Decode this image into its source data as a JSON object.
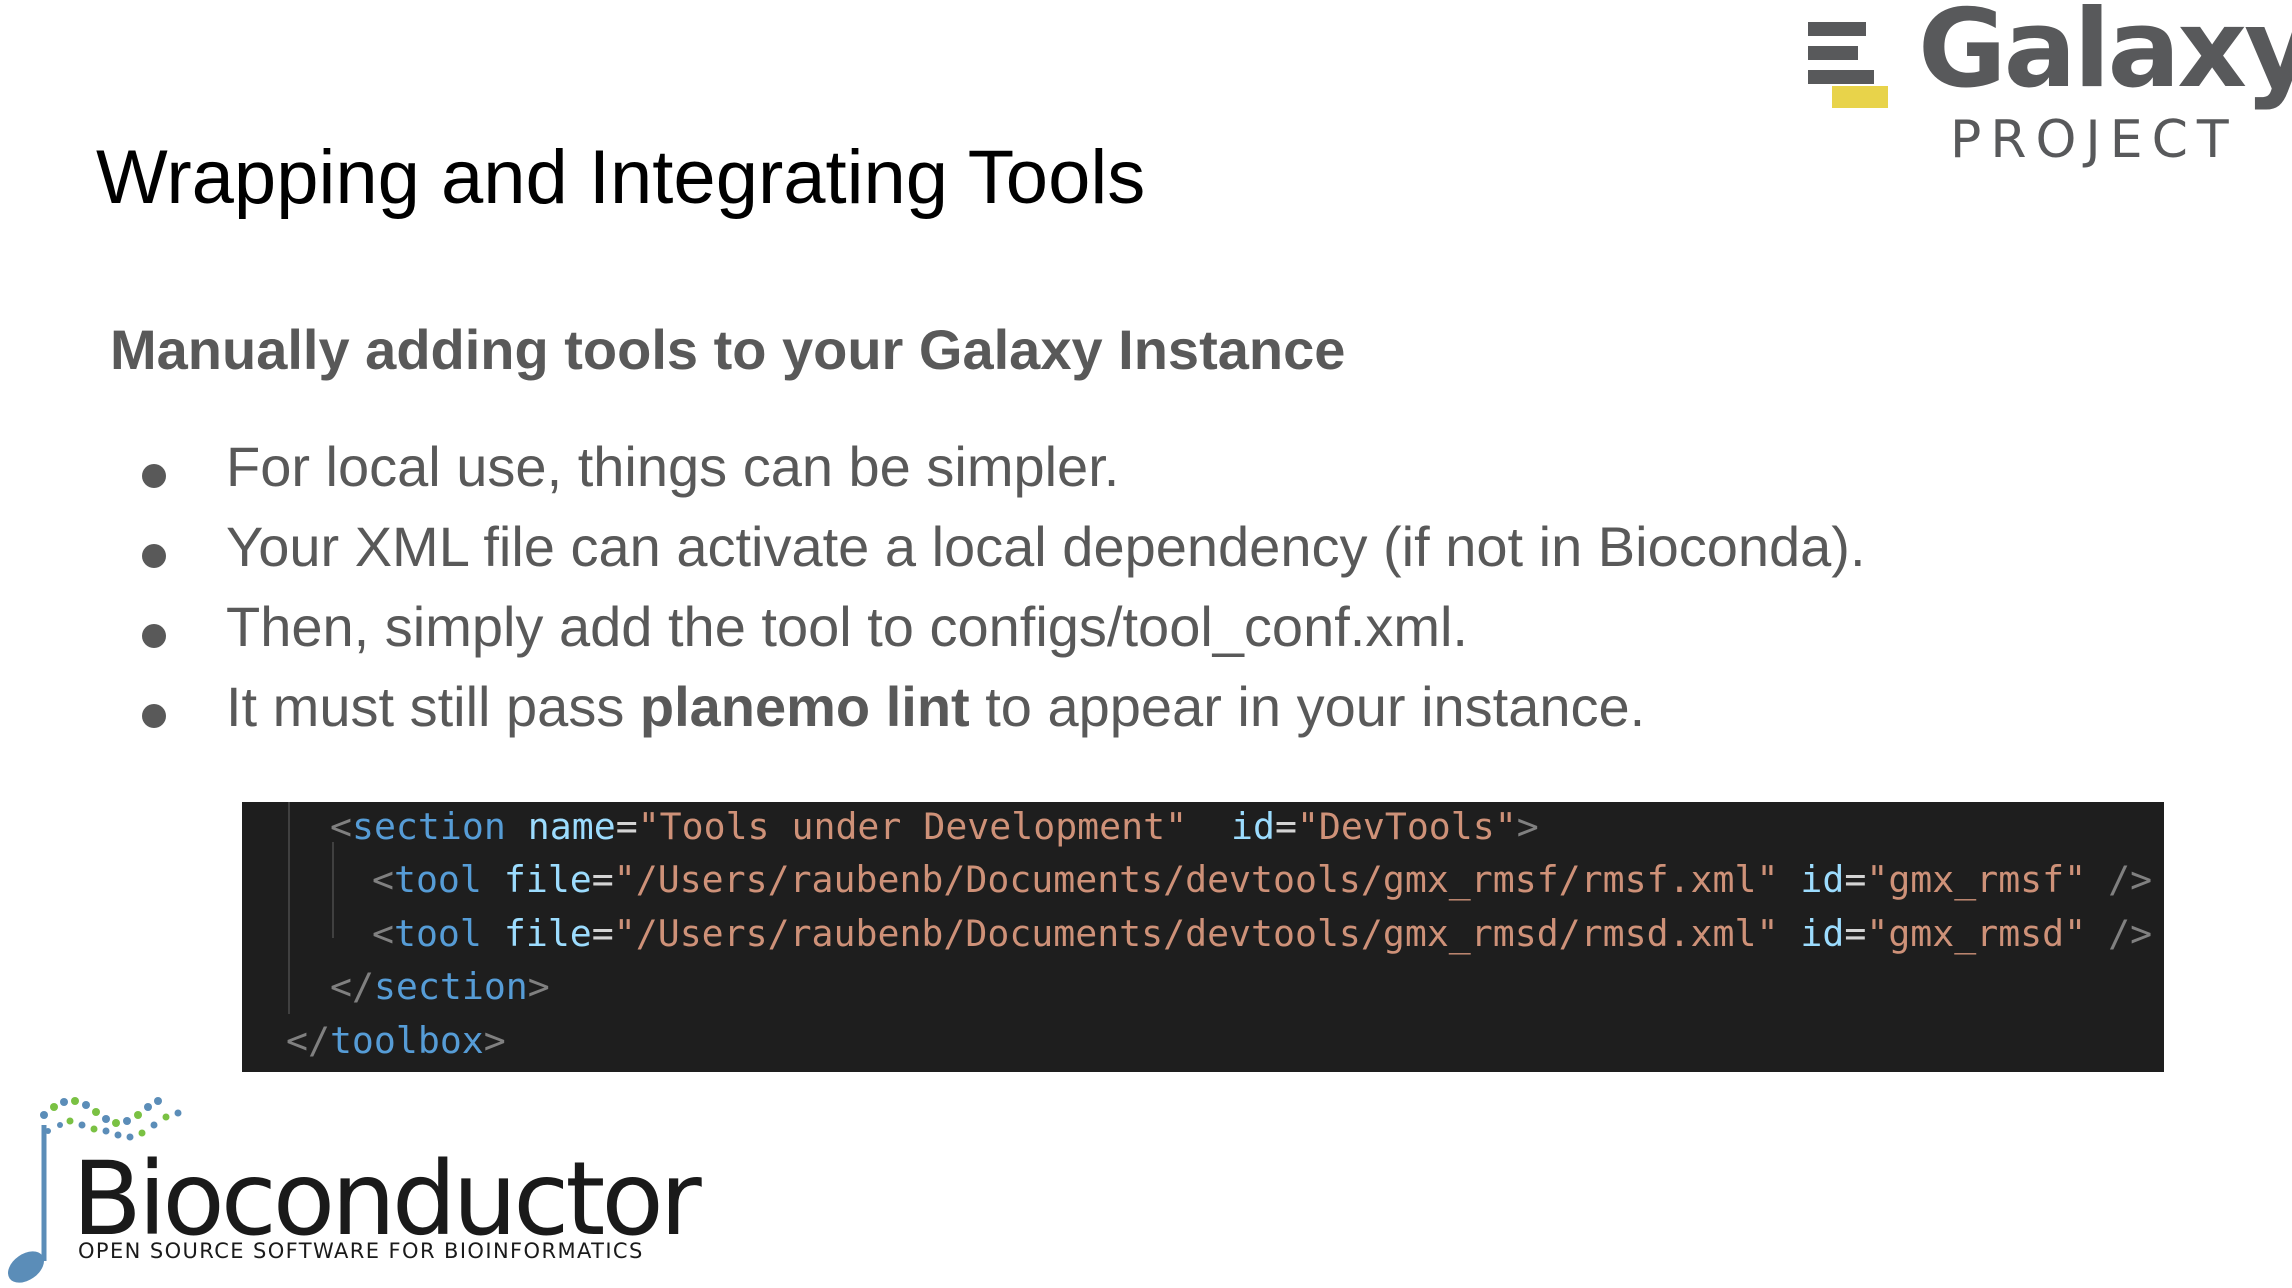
{
  "logos": {
    "galaxy": {
      "wordmark": "Galaxy",
      "subtext": "PROJECT",
      "text_color": "#58595b",
      "accent": "#e8d34a"
    },
    "bioconductor": {
      "wordmark": "Bioconductor",
      "tagline": "OPEN SOURCE SOFTWARE FOR BIOINFORMATICS",
      "note_color": "#5b8db8"
    }
  },
  "slide": {
    "title": "Wrapping and Integrating Tools",
    "subtitle": "Manually adding tools to your Galaxy Instance",
    "bullets": [
      {
        "text": "For local use, things can be simpler."
      },
      {
        "text": "Your XML file can activate a local dependency (if not in Bioconda)."
      },
      {
        "text": "Then, simply add the tool to configs/tool_conf.xml."
      },
      {
        "before": "It must still pass ",
        "bold": "planemo lint",
        "after": " to appear in your instance."
      }
    ]
  },
  "code": {
    "background": "#1e1e1e",
    "colors": {
      "punctuation": "#808080",
      "tag": "#569cd6",
      "attribute": "#9cdcfe",
      "string": "#ce9178"
    },
    "lines": [
      {
        "tag": "section",
        "name_attr": "name",
        "name_val": "\"Tools under Development\"",
        "id_attr": "id",
        "id_val": "\"DevTools\""
      },
      {
        "tag": "tool",
        "file_attr": "file",
        "file_val": "\"/Users/raubenb/Documents/devtools/gmx_rmsf/rmsf.xml\"",
        "id_attr": "id",
        "id_val": "\"gmx_rmsf\""
      },
      {
        "tag": "tool",
        "file_attr": "file",
        "file_val": "\"/Users/raubenb/Documents/devtools/gmx_rmsd/rmsd.xml\"",
        "id_attr": "id",
        "id_val": "\"gmx_rmsd\""
      },
      {
        "close_tag": "section"
      },
      {
        "close_tag": "toolbox"
      }
    ]
  }
}
